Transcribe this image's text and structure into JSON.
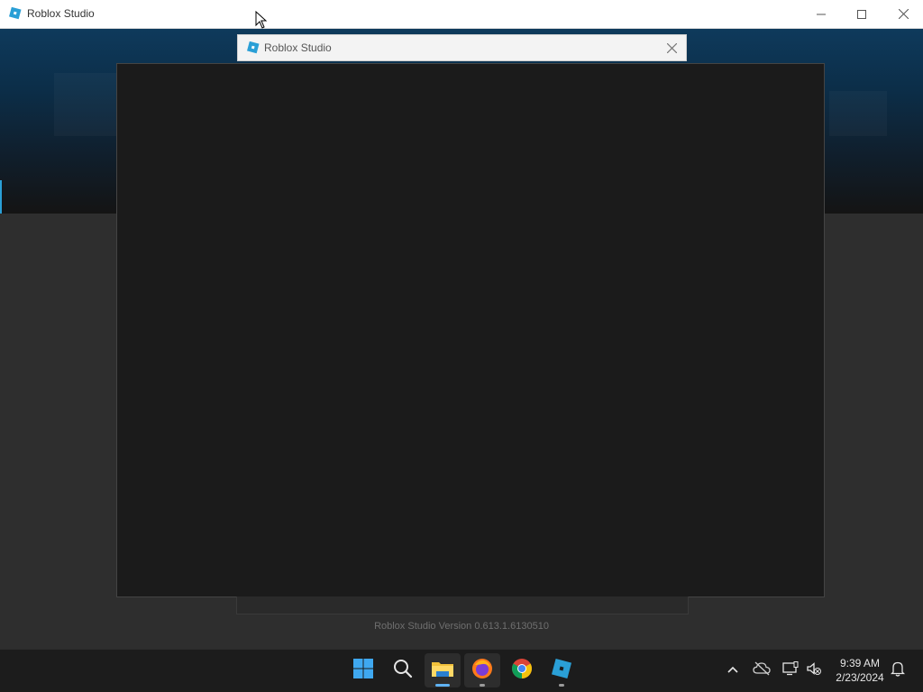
{
  "window": {
    "title": "Roblox Studio"
  },
  "dialog": {
    "title": "Roblox Studio"
  },
  "version_label": "Roblox Studio Version 0.613.1.6130510",
  "taskbar": {
    "apps": [
      {
        "name": "start",
        "icon": "windows-start-icon"
      },
      {
        "name": "search",
        "icon": "search-icon"
      },
      {
        "name": "file-explorer",
        "icon": "folder-icon"
      },
      {
        "name": "firefox",
        "icon": "firefox-icon"
      },
      {
        "name": "chrome",
        "icon": "chrome-icon"
      },
      {
        "name": "roblox-studio",
        "icon": "roblox-studio-icon"
      }
    ],
    "tray": {
      "time": "9:39 AM",
      "date": "2/23/2024"
    }
  },
  "colors": {
    "accent_blue": "#2a9fd6",
    "dialog_body": "#1b1b1b",
    "background": "#2e2e2e"
  }
}
